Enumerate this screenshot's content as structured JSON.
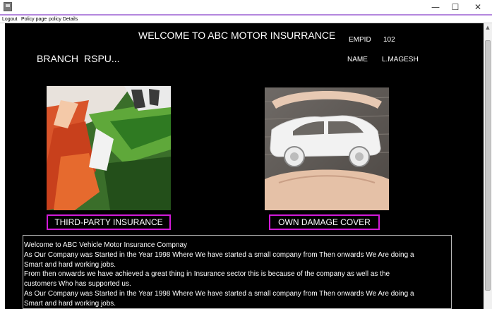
{
  "window": {
    "minimize_glyph": "—",
    "maximize_glyph": "☐",
    "close_glyph": "✕"
  },
  "menu": {
    "items": [
      "Logout",
      "Policy page",
      "policy Details"
    ]
  },
  "header": {
    "welcome": "WELCOME TO ABC MOTOR INSURRANCE",
    "branch_label": "BRANCH",
    "branch_value": "RSPU...",
    "empid_label": "EMPID",
    "empid_value": "102",
    "name_label": "NAME",
    "name_value": "L.MAGESH"
  },
  "products": {
    "third_party": "THIRD-PARTY INSURANCE",
    "own_damage": "OWN DAMAGE COVER"
  },
  "description": {
    "lines": [
      "Welcome to ABC Vehicle Motor Insurance Compnay",
      "As Our Company was Started in the Year 1998 Where We have started a small company from Then onwards We Are doing a",
      "Smart and hard working jobs.",
      "From then onwards we have achieved a great thing in Insurance sector this is because of the company as well as the",
      "customers Who has supported us.",
      "As Our Company was Started in the Year 1998 Where We have started a small company from Then onwards We Are doing a",
      "Smart and hard working jobs."
    ]
  },
  "colors": {
    "background": "#000000",
    "accent_border": "#d21bd8",
    "menubar_accent": "#b487de"
  }
}
